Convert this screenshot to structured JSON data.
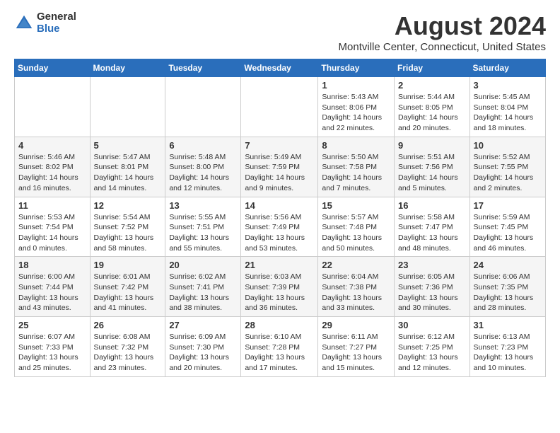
{
  "logo": {
    "general": "General",
    "blue": "Blue"
  },
  "header": {
    "month": "August 2024",
    "location": "Montville Center, Connecticut, United States"
  },
  "weekdays": [
    "Sunday",
    "Monday",
    "Tuesday",
    "Wednesday",
    "Thursday",
    "Friday",
    "Saturday"
  ],
  "weeks": [
    [
      {
        "day": "",
        "sunrise": "",
        "sunset": "",
        "daylight": ""
      },
      {
        "day": "",
        "sunrise": "",
        "sunset": "",
        "daylight": ""
      },
      {
        "day": "",
        "sunrise": "",
        "sunset": "",
        "daylight": ""
      },
      {
        "day": "",
        "sunrise": "",
        "sunset": "",
        "daylight": ""
      },
      {
        "day": "1",
        "sunrise": "Sunrise: 5:43 AM",
        "sunset": "Sunset: 8:06 PM",
        "daylight": "Daylight: 14 hours and 22 minutes."
      },
      {
        "day": "2",
        "sunrise": "Sunrise: 5:44 AM",
        "sunset": "Sunset: 8:05 PM",
        "daylight": "Daylight: 14 hours and 20 minutes."
      },
      {
        "day": "3",
        "sunrise": "Sunrise: 5:45 AM",
        "sunset": "Sunset: 8:04 PM",
        "daylight": "Daylight: 14 hours and 18 minutes."
      }
    ],
    [
      {
        "day": "4",
        "sunrise": "Sunrise: 5:46 AM",
        "sunset": "Sunset: 8:02 PM",
        "daylight": "Daylight: 14 hours and 16 minutes."
      },
      {
        "day": "5",
        "sunrise": "Sunrise: 5:47 AM",
        "sunset": "Sunset: 8:01 PM",
        "daylight": "Daylight: 14 hours and 14 minutes."
      },
      {
        "day": "6",
        "sunrise": "Sunrise: 5:48 AM",
        "sunset": "Sunset: 8:00 PM",
        "daylight": "Daylight: 14 hours and 12 minutes."
      },
      {
        "day": "7",
        "sunrise": "Sunrise: 5:49 AM",
        "sunset": "Sunset: 7:59 PM",
        "daylight": "Daylight: 14 hours and 9 minutes."
      },
      {
        "day": "8",
        "sunrise": "Sunrise: 5:50 AM",
        "sunset": "Sunset: 7:58 PM",
        "daylight": "Daylight: 14 hours and 7 minutes."
      },
      {
        "day": "9",
        "sunrise": "Sunrise: 5:51 AM",
        "sunset": "Sunset: 7:56 PM",
        "daylight": "Daylight: 14 hours and 5 minutes."
      },
      {
        "day": "10",
        "sunrise": "Sunrise: 5:52 AM",
        "sunset": "Sunset: 7:55 PM",
        "daylight": "Daylight: 14 hours and 2 minutes."
      }
    ],
    [
      {
        "day": "11",
        "sunrise": "Sunrise: 5:53 AM",
        "sunset": "Sunset: 7:54 PM",
        "daylight": "Daylight: 14 hours and 0 minutes."
      },
      {
        "day": "12",
        "sunrise": "Sunrise: 5:54 AM",
        "sunset": "Sunset: 7:52 PM",
        "daylight": "Daylight: 13 hours and 58 minutes."
      },
      {
        "day": "13",
        "sunrise": "Sunrise: 5:55 AM",
        "sunset": "Sunset: 7:51 PM",
        "daylight": "Daylight: 13 hours and 55 minutes."
      },
      {
        "day": "14",
        "sunrise": "Sunrise: 5:56 AM",
        "sunset": "Sunset: 7:49 PM",
        "daylight": "Daylight: 13 hours and 53 minutes."
      },
      {
        "day": "15",
        "sunrise": "Sunrise: 5:57 AM",
        "sunset": "Sunset: 7:48 PM",
        "daylight": "Daylight: 13 hours and 50 minutes."
      },
      {
        "day": "16",
        "sunrise": "Sunrise: 5:58 AM",
        "sunset": "Sunset: 7:47 PM",
        "daylight": "Daylight: 13 hours and 48 minutes."
      },
      {
        "day": "17",
        "sunrise": "Sunrise: 5:59 AM",
        "sunset": "Sunset: 7:45 PM",
        "daylight": "Daylight: 13 hours and 46 minutes."
      }
    ],
    [
      {
        "day": "18",
        "sunrise": "Sunrise: 6:00 AM",
        "sunset": "Sunset: 7:44 PM",
        "daylight": "Daylight: 13 hours and 43 minutes."
      },
      {
        "day": "19",
        "sunrise": "Sunrise: 6:01 AM",
        "sunset": "Sunset: 7:42 PM",
        "daylight": "Daylight: 13 hours and 41 minutes."
      },
      {
        "day": "20",
        "sunrise": "Sunrise: 6:02 AM",
        "sunset": "Sunset: 7:41 PM",
        "daylight": "Daylight: 13 hours and 38 minutes."
      },
      {
        "day": "21",
        "sunrise": "Sunrise: 6:03 AM",
        "sunset": "Sunset: 7:39 PM",
        "daylight": "Daylight: 13 hours and 36 minutes."
      },
      {
        "day": "22",
        "sunrise": "Sunrise: 6:04 AM",
        "sunset": "Sunset: 7:38 PM",
        "daylight": "Daylight: 13 hours and 33 minutes."
      },
      {
        "day": "23",
        "sunrise": "Sunrise: 6:05 AM",
        "sunset": "Sunset: 7:36 PM",
        "daylight": "Daylight: 13 hours and 30 minutes."
      },
      {
        "day": "24",
        "sunrise": "Sunrise: 6:06 AM",
        "sunset": "Sunset: 7:35 PM",
        "daylight": "Daylight: 13 hours and 28 minutes."
      }
    ],
    [
      {
        "day": "25",
        "sunrise": "Sunrise: 6:07 AM",
        "sunset": "Sunset: 7:33 PM",
        "daylight": "Daylight: 13 hours and 25 minutes."
      },
      {
        "day": "26",
        "sunrise": "Sunrise: 6:08 AM",
        "sunset": "Sunset: 7:32 PM",
        "daylight": "Daylight: 13 hours and 23 minutes."
      },
      {
        "day": "27",
        "sunrise": "Sunrise: 6:09 AM",
        "sunset": "Sunset: 7:30 PM",
        "daylight": "Daylight: 13 hours and 20 minutes."
      },
      {
        "day": "28",
        "sunrise": "Sunrise: 6:10 AM",
        "sunset": "Sunset: 7:28 PM",
        "daylight": "Daylight: 13 hours and 17 minutes."
      },
      {
        "day": "29",
        "sunrise": "Sunrise: 6:11 AM",
        "sunset": "Sunset: 7:27 PM",
        "daylight": "Daylight: 13 hours and 15 minutes."
      },
      {
        "day": "30",
        "sunrise": "Sunrise: 6:12 AM",
        "sunset": "Sunset: 7:25 PM",
        "daylight": "Daylight: 13 hours and 12 minutes."
      },
      {
        "day": "31",
        "sunrise": "Sunrise: 6:13 AM",
        "sunset": "Sunset: 7:23 PM",
        "daylight": "Daylight: 13 hours and 10 minutes."
      }
    ]
  ]
}
